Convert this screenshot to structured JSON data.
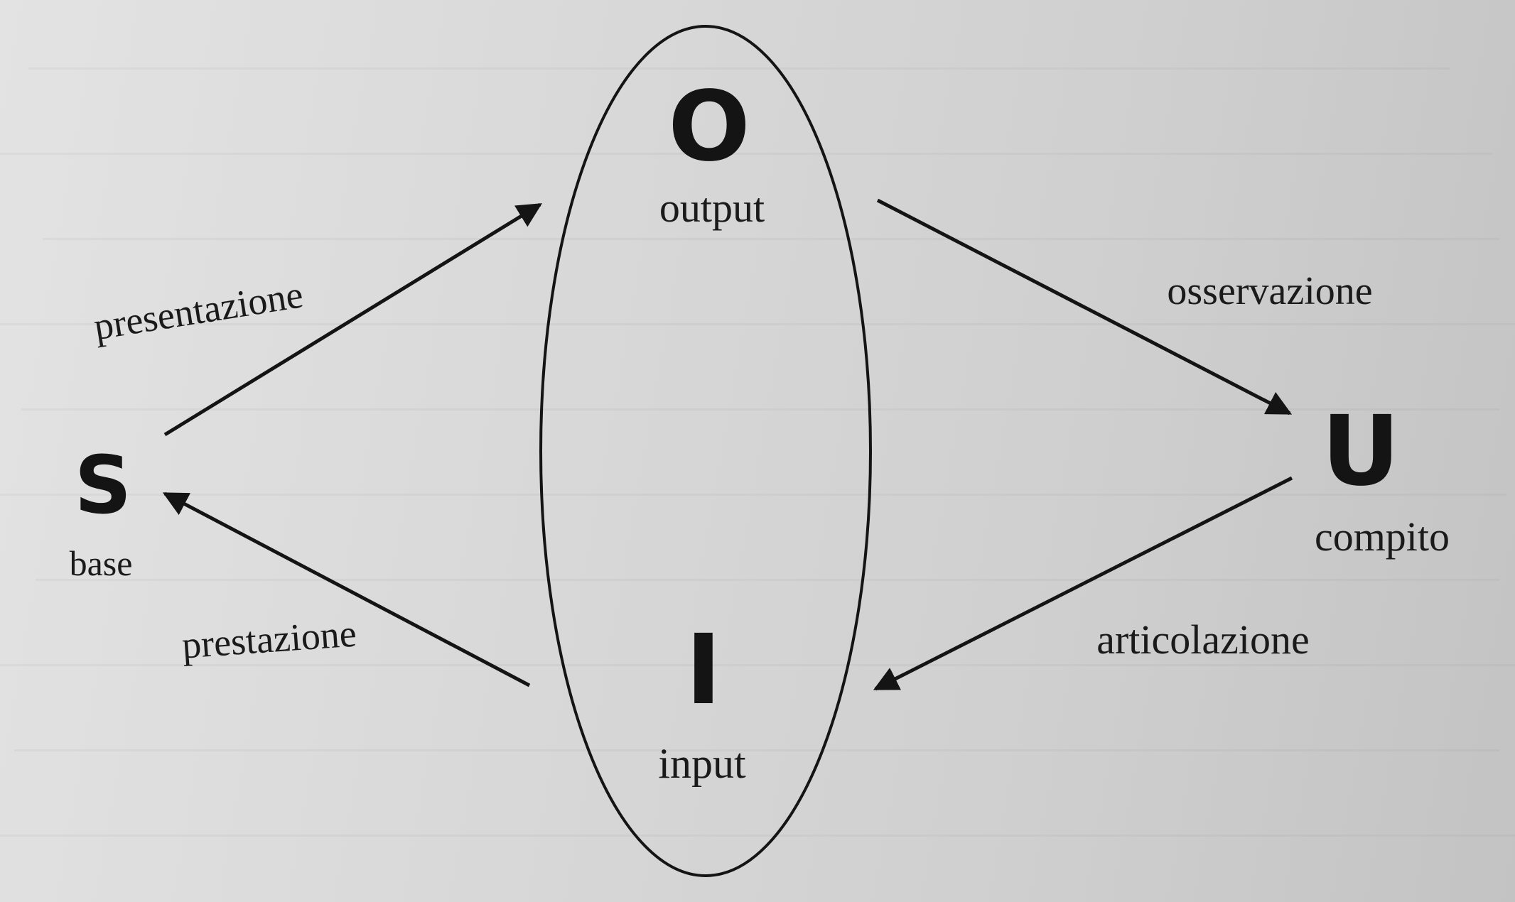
{
  "nodes": {
    "s": {
      "letter": "S",
      "label": "base"
    },
    "o": {
      "letter": "O",
      "label": "output"
    },
    "u": {
      "letter": "U",
      "label": "compito"
    },
    "i": {
      "letter": "I",
      "label": "input"
    }
  },
  "edges": {
    "s_to_o": "presentazione",
    "o_to_u": "osservazione",
    "u_to_i": "articolazione",
    "i_to_s": "prestazione"
  },
  "colors": {
    "ink": "#141414",
    "paper": "#d6d6d6"
  }
}
